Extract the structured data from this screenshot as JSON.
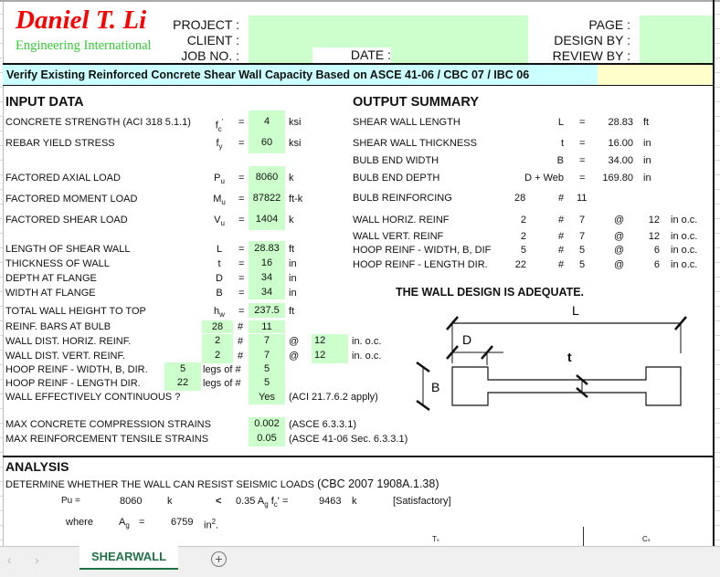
{
  "header": {
    "logo_name": "Daniel T. Li",
    "logo_sub": "Engineering International",
    "project": "PROJECT :",
    "client": "CLIENT :",
    "job_no": "JOB NO. :",
    "date": "DATE :",
    "page": "PAGE :",
    "design_by": "DESIGN BY :",
    "review_by": "REVIEW BY :"
  },
  "title": "Verify Existing Reinforced Concrete Shear Wall Capacity Based on ASCE 41-06 / CBC 07 / IBC 06",
  "input": {
    "heading": "INPUT DATA",
    "rows": [
      {
        "label": "CONCRETE STRENGTH (ACI 318 5.1.1)",
        "sym": "f",
        "sub": "c",
        "sup": "'",
        "eq": "=",
        "value": "4",
        "unit": "ksi"
      },
      {
        "label": "REBAR YIELD STRESS",
        "sym": "f",
        "sub": "y",
        "eq": "=",
        "value": "60",
        "unit": "ksi"
      },
      {
        "label": "FACTORED AXIAL LOAD",
        "sym": "P",
        "sub": "u",
        "eq": "=",
        "value": "8060",
        "unit": "k"
      },
      {
        "label": "FACTORED MOMENT LOAD",
        "sym": "M",
        "sub": "u",
        "eq": "=",
        "value": "87822",
        "unit": "ft-k"
      },
      {
        "label": "FACTORED SHEAR LOAD",
        "sym": "V",
        "sub": "u",
        "eq": "=",
        "value": "1404",
        "unit": "k"
      },
      {
        "label": "LENGTH OF SHEAR WALL",
        "sym": "L",
        "eq": "=",
        "value": "28.83",
        "unit": "ft"
      },
      {
        "label": "THICKNESS OF  WALL",
        "sym": "t",
        "eq": "=",
        "value": "16",
        "unit": "in"
      },
      {
        "label": "DEPTH AT FLANGE",
        "sym": "D",
        "eq": "=",
        "value": "34",
        "unit": "in"
      },
      {
        "label": "WIDTH AT FLANGE",
        "sym": "B",
        "eq": "=",
        "value": "34",
        "unit": "in"
      },
      {
        "label": "TOTAL WALL HEIGHT TO TOP",
        "sym": "h",
        "sub": "w",
        "eq": "=",
        "value": "237.5",
        "unit": "ft"
      }
    ],
    "bulb": {
      "label": "REINF.  BARS AT BULB",
      "count": "28",
      "hash": "#",
      "size": "11"
    },
    "horiz": {
      "label": "WALL DIST. HORIZ. REINF.",
      "count": "2",
      "hash": "#",
      "size": "7",
      "at": "@",
      "spacing": "12",
      "unit": "in. o.c."
    },
    "vert": {
      "label": "WALL DIST. VERT. REINF.",
      "count": "2",
      "hash": "#",
      "size": "7",
      "at": "@",
      "spacing": "12",
      "unit": "in. o.c."
    },
    "hoop_w": {
      "label": "HOOP REINF - WIDTH, B, DIR.",
      "legs": "5",
      "legs_of": "legs of #",
      "size": "5"
    },
    "hoop_l": {
      "label": "HOOP REINF - LENGTH DIR.",
      "legs": "22",
      "legs_of": "legs of #",
      "size": "5"
    },
    "continuous": {
      "label": "WALL EFFECTIVELY CONTINUOUS ?",
      "value": "Yes",
      "note": "(ACI 21.7.6.2 apply)"
    },
    "comp": {
      "label": "MAX CONCRETE COMPRESSION STRAINS",
      "value": "0.002",
      "note": "(ASCE 6.3.3.1)"
    },
    "tens": {
      "label": "MAX REINFORCEMENT TENSILE STRAINS",
      "value": "0.05",
      "note": "(ASCE 41-06 Sec. 6.3.3.1)"
    }
  },
  "output": {
    "heading": "OUTPUT SUMMARY",
    "rows": [
      {
        "label": "SHEAR WALL LENGTH",
        "sym": "L",
        "eq": "=",
        "value": "28.83",
        "unit": "ft"
      },
      {
        "label": "SHEAR WALL THICKNESS",
        "sym": "t",
        "eq": "=",
        "value": "16.00",
        "unit": "in"
      },
      {
        "label": "BULB END WIDTH",
        "sym": "B",
        "eq": "=",
        "value": "34.00",
        "unit": "in"
      },
      {
        "label": "BULB END DEPTH",
        "sym": "D + Web",
        "eq": "=",
        "value": "169.80",
        "unit": "in"
      }
    ],
    "bulb": {
      "label": "BULB REINFORCING",
      "count": "28",
      "hash": "#",
      "size": "11"
    },
    "reinf": [
      {
        "label": "WALL HORIZ. REINF",
        "count": "2",
        "hash": "#",
        "size": "7",
        "at": "@",
        "spacing": "12",
        "unit": "in o.c."
      },
      {
        "label": "WALL VERT. REINF",
        "count": "2",
        "hash": "#",
        "size": "7",
        "at": "@",
        "spacing": "12",
        "unit": "in o.c."
      },
      {
        "label": "HOOP REINF - WIDTH, B, DIF",
        "count": "5",
        "hash": "#",
        "size": "5",
        "at": "@",
        "spacing": "6",
        "unit": "in o.c."
      },
      {
        "label": "HOOP REINF - LENGTH DIR.",
        "count": "22",
        "hash": "#",
        "size": "5",
        "at": "@",
        "spacing": "6",
        "unit": "in o.c."
      }
    ],
    "verdict": "THE WALL DESIGN IS ADEQUATE.",
    "diagram": {
      "L": "L",
      "D": "D",
      "t": "t",
      "B": "B"
    }
  },
  "analysis": {
    "heading": "ANALYSIS",
    "determine": "DETERMINE WHETHER THE WALL CAN RESIST SEISMIC LOADS",
    "code": "(CBC 2007 1908A.1.38)",
    "pu_label": "Pu =",
    "pu": "8060",
    "pu_unit": "k",
    "lt": "<",
    "limit_label": "0.35 A",
    "limit_sub": "g",
    "limit_tail": " f",
    "limit_sub2": "c",
    "limit_end": "' =",
    "limit": "9463",
    "limit_unit": "k",
    "status": "[Satisfactory]",
    "where": "where",
    "ag_label": "A",
    "ag_sub": "g",
    "ag_eq": "=",
    "ag": "6759",
    "ag_unit": "in",
    "ag_sup": "2",
    "ag_dot": ".",
    "ts": "Tₛ",
    "cs": "Cₛ"
  },
  "tabs": {
    "sheet": "SHEARWALL",
    "add": "+",
    "prev": "‹",
    "next": "›"
  },
  "colors": {
    "input_green": "#ccffcc",
    "title_cyan": "#ccffff",
    "title_yellow": "#ffffcc",
    "logo_red": "#ff0000",
    "logo_green": "#33cc33"
  }
}
